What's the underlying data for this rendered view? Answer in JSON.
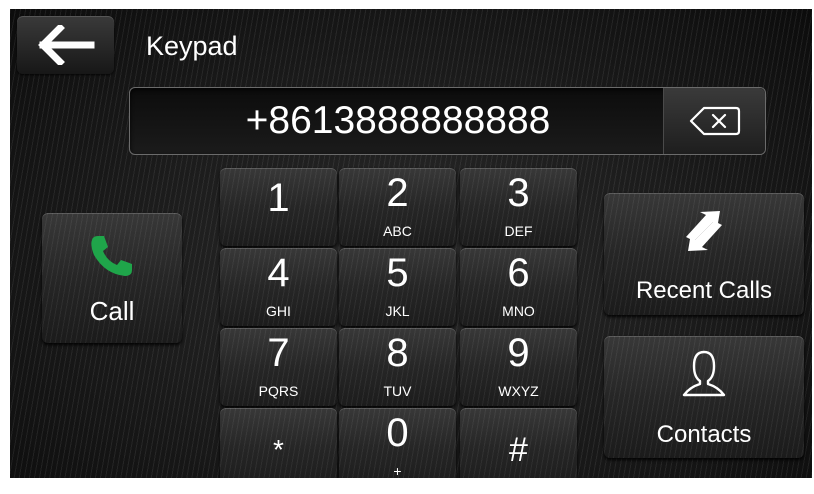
{
  "header": {
    "back_icon": "arrow-left-icon",
    "title": "Keypad"
  },
  "display": {
    "number": "+8613888888888",
    "backspace_icon": "backspace-icon"
  },
  "keypad": {
    "keys": [
      {
        "digit": "1",
        "letters": ""
      },
      {
        "digit": "2",
        "letters": "ABC"
      },
      {
        "digit": "3",
        "letters": "DEF"
      },
      {
        "digit": "4",
        "letters": "GHI"
      },
      {
        "digit": "5",
        "letters": "JKL"
      },
      {
        "digit": "6",
        "letters": "MNO"
      },
      {
        "digit": "7",
        "letters": "PQRS"
      },
      {
        "digit": "8",
        "letters": "TUV"
      },
      {
        "digit": "9",
        "letters": "WXYZ"
      },
      {
        "digit": "*",
        "letters": ""
      },
      {
        "digit": "0",
        "letters": "+"
      },
      {
        "digit": "#",
        "letters": ""
      }
    ]
  },
  "actions": {
    "call_label": "Call",
    "call_icon": "phone-icon",
    "recent_label": "Recent Calls",
    "recent_icon": "swap-arrows-icon",
    "contacts_label": "Contacts",
    "contacts_icon": "person-icon"
  },
  "colors": {
    "call_green": "#1fa54a",
    "background": "#141414",
    "text": "#ffffff"
  }
}
